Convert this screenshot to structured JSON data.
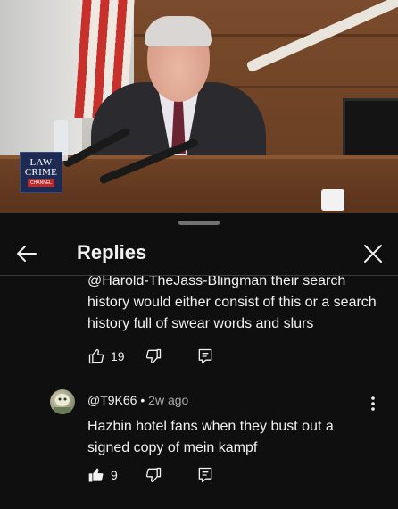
{
  "video": {
    "logo": {
      "line1": "LAW",
      "line2": "CRIME",
      "line3": "CHANNEL"
    }
  },
  "sheet": {
    "title": "Replies",
    "back_icon": "arrow-left-icon",
    "close_icon": "close-icon"
  },
  "comments": [
    {
      "text": "@Harold-TheJass-Blingman their search history would either consist of this or a search history full of swear words and slurs",
      "likes": "19",
      "liked": false
    },
    {
      "author": "@T9K66",
      "separator": " • ",
      "time": "2w ago",
      "text": "Hazbin hotel fans when they bust out a signed copy of mein kampf",
      "likes": "9",
      "liked": true
    }
  ],
  "colors": {
    "background": "#0f0f0f",
    "text": "#f1f1f1",
    "secondary": "#aaaaaa"
  }
}
